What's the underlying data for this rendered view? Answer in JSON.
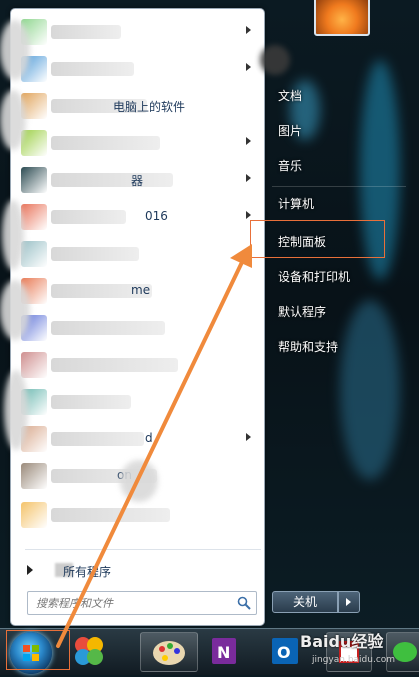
{
  "start_menu": {
    "programs": [
      {
        "text": "",
        "has_arrow": true,
        "icon_color": "#8fd68f"
      },
      {
        "text": "",
        "has_arrow": true,
        "icon_color": "#4f9bd8"
      },
      {
        "text": "电脑上的软件",
        "has_arrow": false,
        "icon_color": "#e0a35a"
      },
      {
        "text": "",
        "has_arrow": true,
        "icon_color": "#9ccf46"
      },
      {
        "text": "器",
        "has_arrow": true,
        "icon_color": "#2c4b52"
      },
      {
        "text": "016",
        "has_arrow": true,
        "icon_color": "#e8735a"
      },
      {
        "text": "",
        "has_arrow": false,
        "icon_color": "#9ac0c6"
      },
      {
        "text": "me",
        "has_arrow": false,
        "icon_color": "#e87a55"
      },
      {
        "text": "",
        "has_arrow": false,
        "icon_color": "#5e73d8"
      },
      {
        "text": "",
        "has_arrow": false,
        "icon_color": "#cf8f8f"
      },
      {
        "text": "",
        "has_arrow": false,
        "icon_color": "#6ab8b0"
      },
      {
        "text": "d",
        "has_arrow": true,
        "icon_color": "#d8a88c"
      },
      {
        "text": "on",
        "has_arrow": false,
        "icon_color": "#9a8a7a"
      },
      {
        "text": "",
        "has_arrow": false,
        "icon_color": "#f4c36a"
      }
    ],
    "all_programs": "所有程序",
    "search_placeholder": "搜索程序和文件",
    "right_items": [
      "文档",
      "图片",
      "音乐",
      "计算机",
      "控制面板",
      "设备和打印机",
      "默认程序",
      "帮助和支持"
    ],
    "shutdown_label": "关机"
  },
  "watermark": {
    "main": "Baidu经验",
    "sub": "jingyan.baidu.com"
  }
}
